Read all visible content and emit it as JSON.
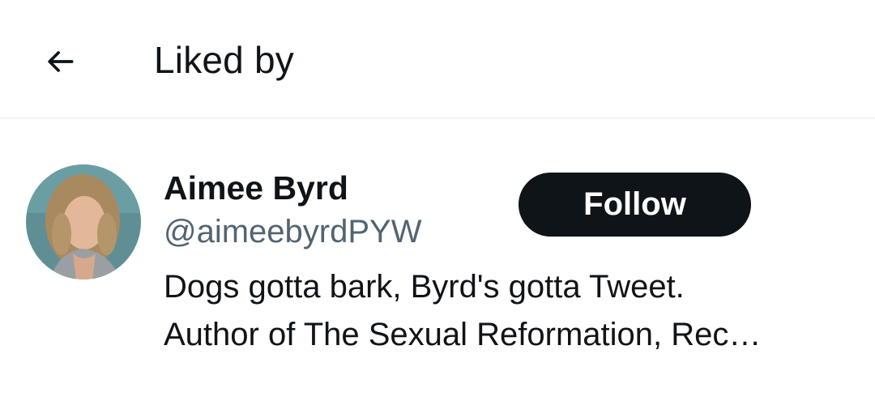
{
  "header": {
    "back_icon": "arrow-left-icon",
    "title": "Liked by"
  },
  "users": [
    {
      "name": "Aimee Byrd",
      "handle": "@aimeebyrdPYW",
      "follow_label": "Follow",
      "bio_lines": [
        "Dogs gotta bark, Byrd's gotta Tweet.",
        "Author of The Sexual Reformation, Rec…"
      ],
      "avatar_icon": "profile-photo"
    }
  ],
  "colors": {
    "text_primary": "#0f1419",
    "text_secondary": "#536471",
    "button_bg": "#0f1419",
    "button_text": "#ffffff",
    "divider": "#e6e9ec"
  }
}
